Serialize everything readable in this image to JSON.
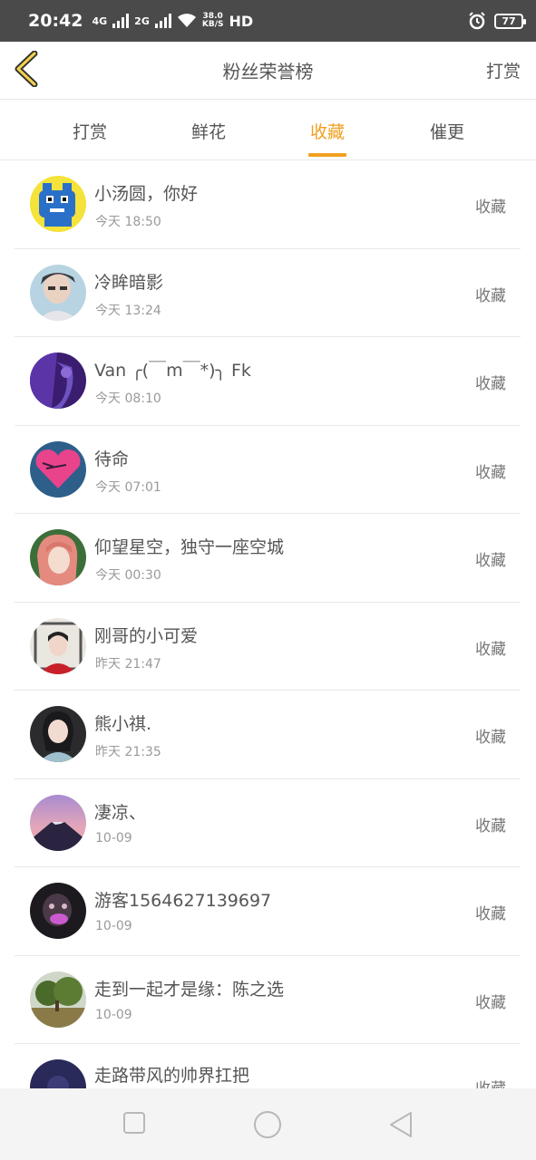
{
  "status_bar": {
    "time": "20:42",
    "net1": "4G",
    "net2": "2G",
    "speed_value": "38.0",
    "speed_unit": "KB/S",
    "hd": "HD",
    "battery": "77"
  },
  "header": {
    "back_icon": "chevron-left-icon",
    "title": "粉丝荣誉榜",
    "action": "打赏",
    "accent": "#f0a020"
  },
  "tabs": [
    {
      "label": "打赏",
      "active": false
    },
    {
      "label": "鲜花",
      "active": false
    },
    {
      "label": "收藏",
      "active": true
    },
    {
      "label": "催更",
      "active": false
    }
  ],
  "fans": [
    {
      "name": "小汤圆，你好",
      "time": "今天  18:50",
      "action": "收藏"
    },
    {
      "name": "冷眸暗影",
      "time": "今天  13:24",
      "action": "收藏"
    },
    {
      "name": "Van ╭(￣m￣*)╮ Fk",
      "time": "今天  08:10",
      "action": "收藏"
    },
    {
      "name": "待命",
      "time": "今天  07:01",
      "action": "收藏"
    },
    {
      "name": "仰望星空，独守一座空城",
      "time": "今天  00:30",
      "action": "收藏"
    },
    {
      "name": "刚哥的小可爱",
      "time": "昨天  21:47",
      "action": "收藏"
    },
    {
      "name": "熊小祺.",
      "time": "昨天  21:35",
      "action": "收藏"
    },
    {
      "name": "凄凉、",
      "time": "10-09",
      "action": "收藏"
    },
    {
      "name": "游客1564627139697",
      "time": "10-09",
      "action": "收藏"
    },
    {
      "name": "走到一起才是缘：陈之选",
      "time": "10-09",
      "action": "收藏"
    },
    {
      "name": "走路带风的帅界扛把",
      "time": "",
      "action": "收藏"
    }
  ],
  "system_nav": {
    "recent_icon": "square-icon",
    "home_icon": "circle-icon",
    "back_icon": "triangle-back-icon"
  }
}
